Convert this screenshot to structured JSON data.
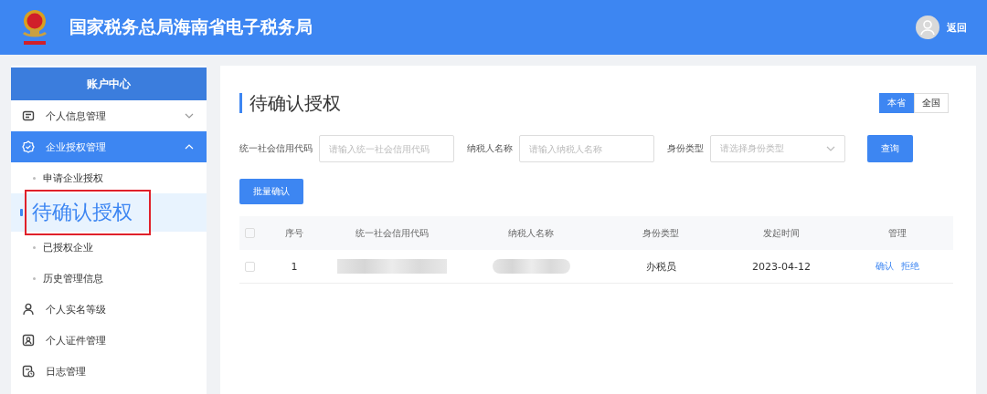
{
  "header": {
    "title": "国家税务总局海南省电子税务局",
    "back_label": "返回"
  },
  "sidebar": {
    "title": "账户中心",
    "items": [
      {
        "label": "个人信息管理",
        "selected": false,
        "expanded": false
      },
      {
        "label": "企业授权管理",
        "selected": true,
        "expanded": true,
        "children": [
          {
            "label": "申请企业授权",
            "selected": false
          },
          {
            "label": "待确认授权",
            "selected": true
          },
          {
            "label": "已授权企业",
            "selected": false
          },
          {
            "label": "历史管理信息",
            "selected": false
          }
        ]
      },
      {
        "label": "个人实名等级",
        "selected": false
      },
      {
        "label": "个人证件管理",
        "selected": false
      },
      {
        "label": "日志管理",
        "selected": false
      }
    ]
  },
  "page_title": "待确认授权",
  "scope_toggle": [
    {
      "label": "本省",
      "selected": true
    },
    {
      "label": "全国",
      "selected": false
    }
  ],
  "filters": [
    {
      "kind": "text",
      "label": "统一社会信用代码",
      "placeholder": "请输入统一社会信用代码"
    },
    {
      "kind": "text",
      "label": "纳税人名称",
      "placeholder": "请输入纳税人名称"
    },
    {
      "kind": "select",
      "label": "身份类型",
      "placeholder": "请选择身份类型"
    }
  ],
  "search_button": "查询",
  "batch_button": "批量确认",
  "table": {
    "select_all_checked": false,
    "columns": [
      "序号",
      "统一社会信用代码",
      "纳税人名称",
      "身份类型",
      "发起时间",
      "管理"
    ],
    "rows": [
      {
        "checked": false,
        "index": "1",
        "role": "办税员",
        "date": "2023-04-12",
        "actions": [
          "确认",
          "拒绝"
        ]
      }
    ]
  }
}
